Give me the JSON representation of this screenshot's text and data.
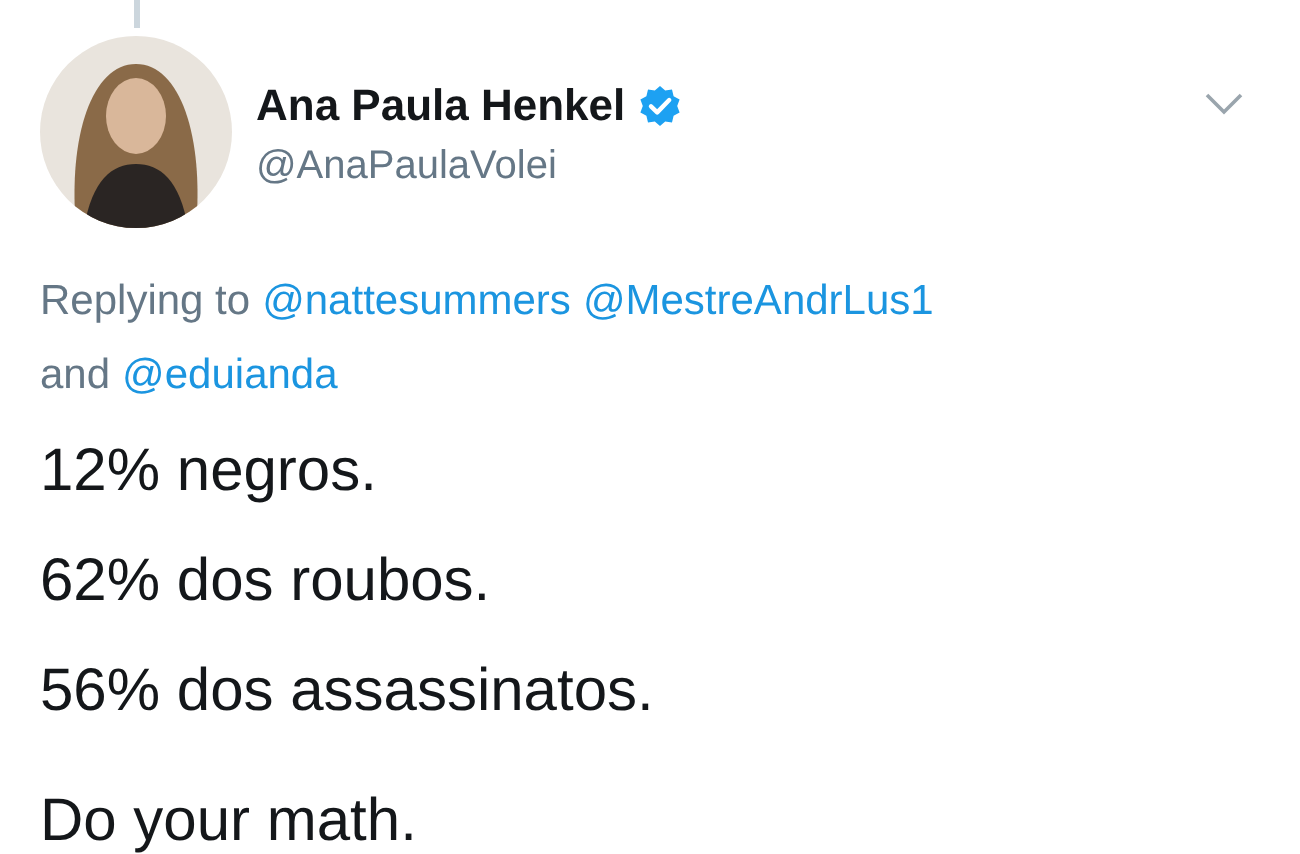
{
  "author": {
    "name": "Ana Paula Henkel",
    "verified": true,
    "handle": "@AnaPaulaVolei"
  },
  "reply_lines": [
    [
      {
        "kind": "text",
        "text": "Replying to"
      },
      {
        "kind": "mention",
        "text": "@nattesummers"
      },
      {
        "kind": "mention",
        "text": "@MestreAndrLus1"
      }
    ],
    [
      {
        "kind": "text",
        "text": "and"
      },
      {
        "kind": "mention",
        "text": "@eduianda"
      }
    ]
  ],
  "paragraphs": [
    [
      "12% negros.",
      "62% dos roubos.",
      "56% dos assassinatos."
    ],
    [
      "Do your math."
    ]
  ]
}
